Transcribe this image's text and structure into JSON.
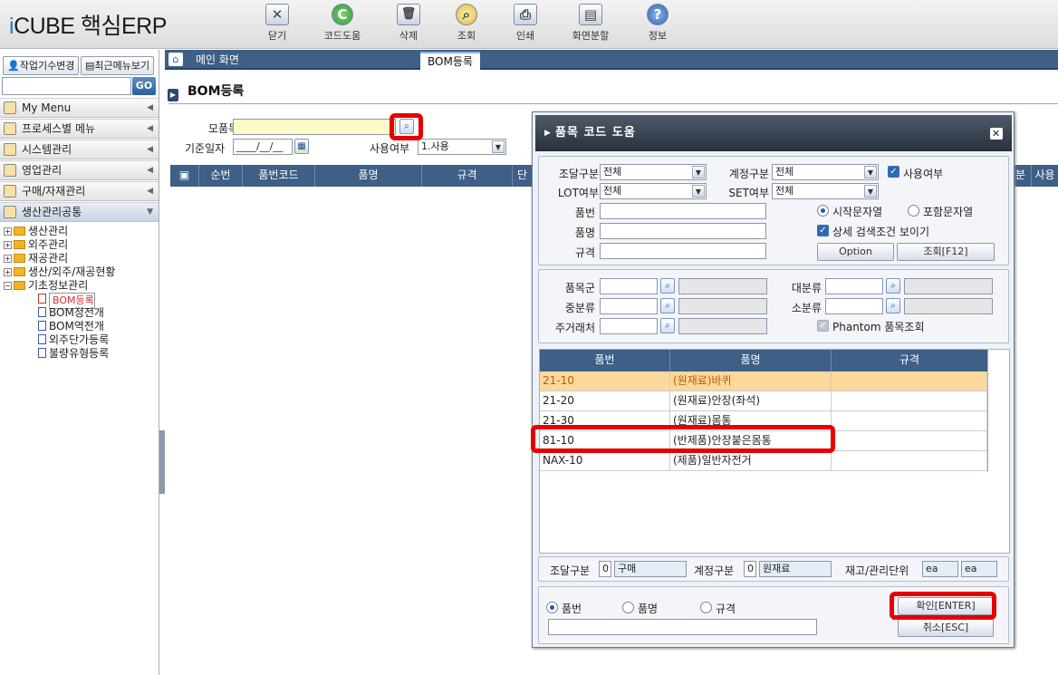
{
  "app": {
    "logo_prefix": "i",
    "logo_rest": "CUBE 핵심ERP"
  },
  "toolbar": [
    {
      "label": "닫기",
      "icon": "close-icon",
      "glyph": "✕"
    },
    {
      "label": "코드도움",
      "icon": "code-help-icon",
      "glyph": "C"
    },
    {
      "label": "삭제",
      "icon": "trash-icon",
      "glyph": "🗑"
    },
    {
      "label": "조회",
      "icon": "search-icon",
      "glyph": "⌕"
    },
    {
      "label": "인쇄",
      "icon": "print-icon",
      "glyph": "⎙"
    },
    {
      "label": "화면분할",
      "icon": "split-screen-icon",
      "glyph": "▤"
    },
    {
      "label": "정보",
      "icon": "info-icon",
      "glyph": "?"
    }
  ],
  "left": {
    "btn_change": "작업기수변경",
    "btn_recent": "최근메뉴보기",
    "go": "GO",
    "menus": [
      "My Menu",
      "프로세스별 메뉴",
      "시스템관리",
      "영업관리",
      "구매/자재관리",
      "생산관리공통"
    ],
    "tree": [
      "생산관리",
      "외주관리",
      "재공관리",
      "생산/외주/재공현황",
      "기초정보관리"
    ],
    "subtree": [
      "BOM등록",
      "BOM정전개",
      "BOM역전개",
      "외주단가등록",
      "불량유형등록"
    ]
  },
  "tabs": {
    "home": "메인 화면",
    "active": "BOM등록"
  },
  "page": {
    "title": "BOM등록",
    "lbl_parent": "모품목",
    "lbl_date": "기준일자",
    "date_value": "____/__/__",
    "lbl_use": "사용여부",
    "use_value": "1.사용"
  },
  "grid_headers": [
    "순번",
    "품번코드",
    "품명",
    "규격",
    "단위",
    "분",
    "사용"
  ],
  "dialog": {
    "title": "품목 코드 도움",
    "lbl_supply": "조달구분",
    "supply_value": "전체",
    "lbl_account": "계정구분",
    "account_value": "전체",
    "lbl_use": "사용여부",
    "lbl_lot": "LOT여부",
    "lot_value": "전체",
    "lbl_set": "SET여부",
    "set_value": "전체",
    "lbl_itemno": "품번",
    "lbl_itemname": "품명",
    "lbl_spec": "규격",
    "radio_start": "시작문자열",
    "radio_contain": "포함문자열",
    "chk_detail": "상세 검색조건 보이기",
    "btn_option": "Option",
    "btn_search": "조회[F12]",
    "lbl_group": "품목군",
    "lbl_big": "대분류",
    "lbl_mid": "중분류",
    "lbl_small": "소분류",
    "lbl_vendor": "주거래처",
    "chk_phantom": "Phantom 품목조회",
    "grid_headers": [
      "품번",
      "품명",
      "규격"
    ],
    "rows": [
      {
        "code": "21-10",
        "name": "(원재료)바퀴",
        "spec": ""
      },
      {
        "code": "21-20",
        "name": "(원재료)안장(좌석)",
        "spec": ""
      },
      {
        "code": "21-30",
        "name": "(원재료)몸통",
        "spec": ""
      },
      {
        "code": "81-10",
        "name": "(반제품)안장붙은몸통",
        "spec": ""
      },
      {
        "code": "NAX-10",
        "name": "(제품)일반자전거",
        "spec": ""
      }
    ],
    "info_supply_lbl": "조달구분",
    "info_supply_code": "0",
    "info_supply_val": "구매",
    "info_account_lbl": "계정구분",
    "info_account_code": "0",
    "info_account_val": "원재료",
    "info_unit_lbl": "재고/관리단위",
    "info_unit1": "ea",
    "info_unit2": "ea",
    "r_itemno": "품번",
    "r_itemname": "품명",
    "r_spec": "규격",
    "btn_ok": "확인[ENTER]",
    "btn_cancel": "취소[ESC]"
  },
  "colors": {
    "header": "#3e5f86",
    "highlight_row": "#fcd89c",
    "red_box": "#e60000"
  }
}
